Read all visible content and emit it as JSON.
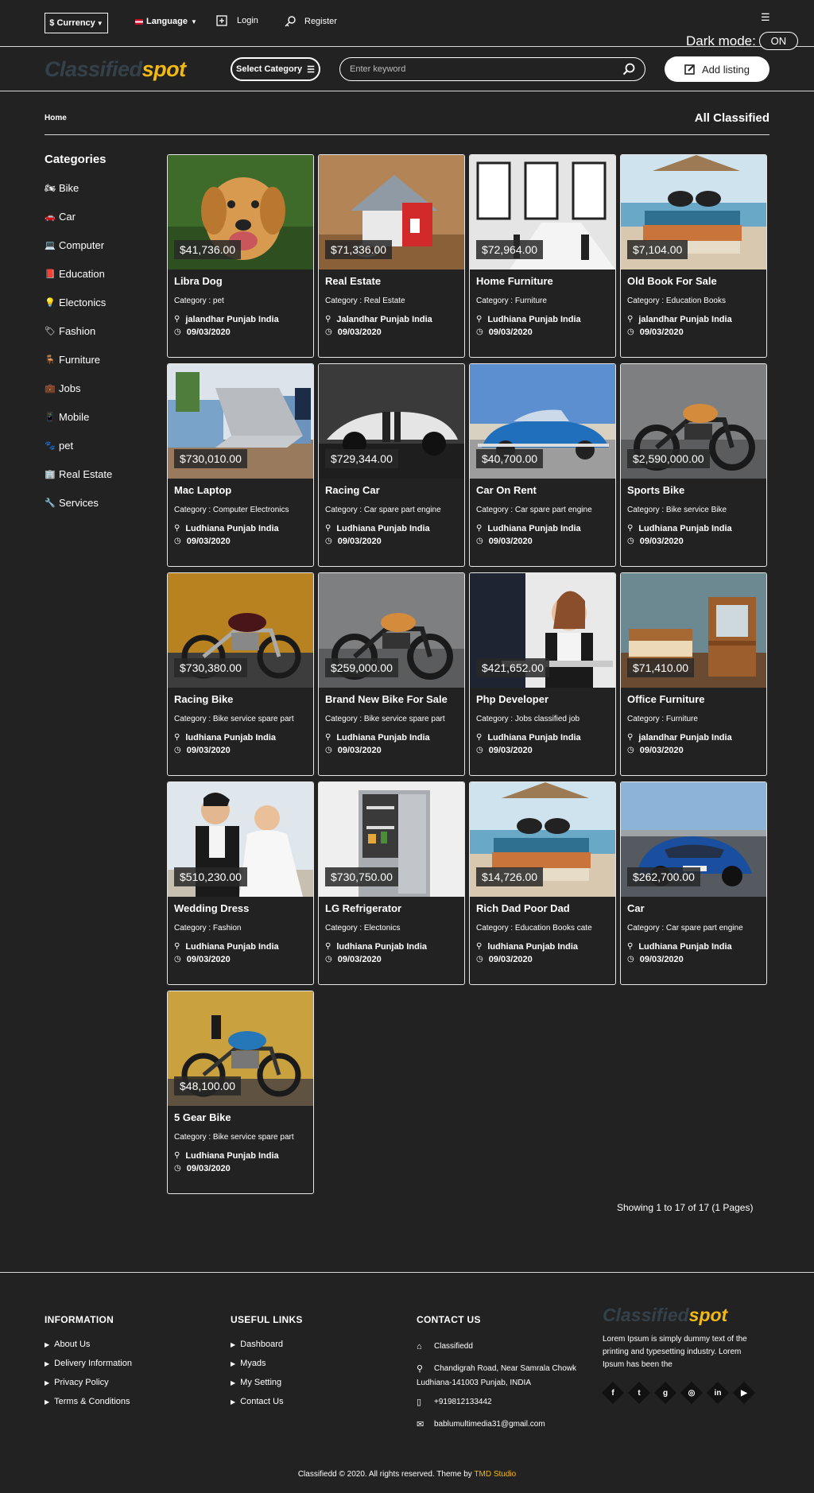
{
  "topbar": {
    "currency_label": "$ Currency",
    "language_label": "Language",
    "login_label": "Login",
    "register_label": "Register",
    "dark_mode_label": "Dark mode:",
    "dark_mode_state": "ON"
  },
  "header": {
    "logo_part1": "Classified",
    "logo_part2": "spot",
    "select_category_label": "Select Category",
    "search_placeholder": "Enter keyword",
    "add_listing_label": "Add listing"
  },
  "breadcrumb": {
    "home": "Home"
  },
  "page_title": "All Classified",
  "sidebar": {
    "title": "Categories",
    "items": [
      {
        "label": "Bike",
        "icon": "motorbike-icon"
      },
      {
        "label": "Car",
        "icon": "car-icon"
      },
      {
        "label": "Computer",
        "icon": "computer-icon"
      },
      {
        "label": "Education",
        "icon": "book-icon"
      },
      {
        "label": "Electonics",
        "icon": "lightbulb-icon"
      },
      {
        "label": "Fashion",
        "icon": "tag-icon"
      },
      {
        "label": "Furniture",
        "icon": "chair-icon"
      },
      {
        "label": "Jobs",
        "icon": "briefcase-icon"
      },
      {
        "label": "Mobile",
        "icon": "mobile-icon"
      },
      {
        "label": "pet",
        "icon": "paw-icon"
      },
      {
        "label": "Real Estate",
        "icon": "building-icon"
      },
      {
        "label": "Services",
        "icon": "tools-icon"
      }
    ]
  },
  "listings": [
    {
      "price": "$41,736.00",
      "title": "Libra Dog",
      "category": "Category : pet",
      "location": "jalandhar Punjab India",
      "date": "09/03/2020",
      "image": "dog"
    },
    {
      "price": "$71,336.00",
      "title": "Real Estate",
      "category": "Category : Real Estate",
      "location": "Jalandhar Punjab India",
      "date": "09/03/2020",
      "image": "house"
    },
    {
      "price": "$72,964.00",
      "title": "Home Furniture",
      "category": "Category : Furniture",
      "location": "Ludhiana Punjab India",
      "date": "09/03/2020",
      "image": "room"
    },
    {
      "price": "$7,104.00",
      "title": "Old Book For Sale",
      "category": "Category : Education Books",
      "location": "jalandhar Punjab India",
      "date": "09/03/2020",
      "image": "books"
    },
    {
      "price": "$730,010.00",
      "title": "Mac Laptop",
      "category": "Category : Computer Electronics",
      "location": "Ludhiana Punjab India",
      "date": "09/03/2020",
      "image": "laptop"
    },
    {
      "price": "$729,344.00",
      "title": "Racing Car",
      "category": "Category : Car spare part engine",
      "location": "Ludhiana Punjab India",
      "date": "09/03/2020",
      "image": "racecar"
    },
    {
      "price": "$40,700.00",
      "title": "Car On Rent",
      "category": "Category : Car spare part engine",
      "location": "Ludhiana Punjab India",
      "date": "09/03/2020",
      "image": "classiccar"
    },
    {
      "price": "$2,590,000.00",
      "title": "Sports Bike",
      "category": "Category : Bike service Bike",
      "location": "Ludhiana Punjab India",
      "date": "09/03/2020",
      "image": "bike"
    },
    {
      "price": "$730,380.00",
      "title": "Racing Bike",
      "category": "Category : Bike service spare part",
      "location": "ludhiana Punjab India",
      "date": "09/03/2020",
      "image": "bike2"
    },
    {
      "price": "$259,000.00",
      "title": "Brand New Bike For Sale",
      "category": "Category : Bike service spare part",
      "location": "Ludhiana Punjab India",
      "date": "09/03/2020",
      "image": "bike"
    },
    {
      "price": "$421,652.00",
      "title": "Php Developer",
      "category": "Category : Jobs classified job",
      "location": "Ludhiana Punjab India",
      "date": "09/03/2020",
      "image": "office"
    },
    {
      "price": "$71,410.00",
      "title": "Office Furniture",
      "category": "Category : Furniture",
      "location": "jalandhar Punjab India",
      "date": "09/03/2020",
      "image": "bedroom"
    },
    {
      "price": "$510,230.00",
      "title": "Wedding Dress",
      "category": "Category : Fashion",
      "location": "Ludhiana Punjab India",
      "date": "09/03/2020",
      "image": "wedding"
    },
    {
      "price": "$730,750.00",
      "title": "LG Refrigerator",
      "category": "Category : Electonics",
      "location": "ludhiana Punjab India",
      "date": "09/03/2020",
      "image": "fridge"
    },
    {
      "price": "$14,726.00",
      "title": "Rich Dad Poor Dad",
      "category": "Category : Education Books cate",
      "location": "ludhiana Punjab India",
      "date": "09/03/2020",
      "image": "books"
    },
    {
      "price": "$262,700.00",
      "title": "Car",
      "category": "Category : Car spare part engine",
      "location": "Ludhiana Punjab India",
      "date": "09/03/2020",
      "image": "sportscar"
    },
    {
      "price": "$48,100.00",
      "title": "5 Gear Bike",
      "category": "Category : Bike service spare part",
      "location": "Ludhiana Punjab India",
      "date": "09/03/2020",
      "image": "bluebike"
    }
  ],
  "pagination_text": "Showing 1 to 17 of 17 (1 Pages)",
  "footer": {
    "information": {
      "title": "INFORMATION",
      "links": [
        "About Us",
        "Delivery Information",
        "Privacy Policy",
        "Terms & Conditions"
      ]
    },
    "useful_links": {
      "title": "USEFUL LINKS",
      "links": [
        "Dashboard",
        "Myads",
        "My Setting",
        "Contact Us"
      ]
    },
    "contact": {
      "title": "CONTACT US",
      "name": "Classifiedd",
      "address_line1": "Chandigrah Road, Near Samrala Chowk",
      "address_line2": "Ludhiana-141003 Punjab, INDIA",
      "phone": "+919812133442",
      "email": "bablumultimedia31@gmail.com"
    },
    "about": {
      "logo_part1": "Classified",
      "logo_part2": "spot",
      "text": "Lorem Ipsum is simply dummy text of the printing and typesetting industry. Lorem Ipsum has been the"
    },
    "socials": [
      {
        "name": "facebook-icon",
        "glyph": "f"
      },
      {
        "name": "twitter-icon",
        "glyph": "t"
      },
      {
        "name": "google-plus-icon",
        "glyph": "g"
      },
      {
        "name": "instagram-icon",
        "glyph": "◎"
      },
      {
        "name": "linkedin-icon",
        "glyph": "in"
      },
      {
        "name": "youtube-icon",
        "glyph": "▶"
      }
    ],
    "copyright": "Classifiedd © 2020. All rights reserved. Theme by",
    "studio": "TMD Studio"
  },
  "colors": {
    "background": "#222222",
    "accent": "#f3b913",
    "logo_dark": "#34414a",
    "border": "#d8d8d8"
  }
}
